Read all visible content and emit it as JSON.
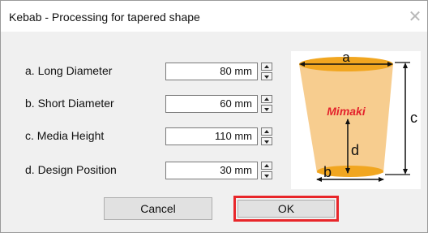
{
  "window": {
    "title": "Kebab - Processing for tapered shape",
    "close_symbol": "✕"
  },
  "rows": [
    {
      "label": "a. Long Diameter",
      "value": "80 mm"
    },
    {
      "label": "b. Short Diameter",
      "value": "60 mm"
    },
    {
      "label": "c. Media Height",
      "value": "110 mm"
    },
    {
      "label": "d. Design Position",
      "value": "30 mm"
    }
  ],
  "diagram": {
    "letters": {
      "a": "a",
      "b": "b",
      "c": "c",
      "d": "d"
    },
    "brand": "Mimaki",
    "colors": {
      "cup": "#f7cd8f",
      "ellipse": "#f1a620",
      "brand_red": "#e4222c"
    }
  },
  "buttons": {
    "cancel": "Cancel",
    "ok": "OK"
  },
  "colors": {
    "highlight": "#e8262a",
    "dialog_bg": "#f0f0f0"
  }
}
